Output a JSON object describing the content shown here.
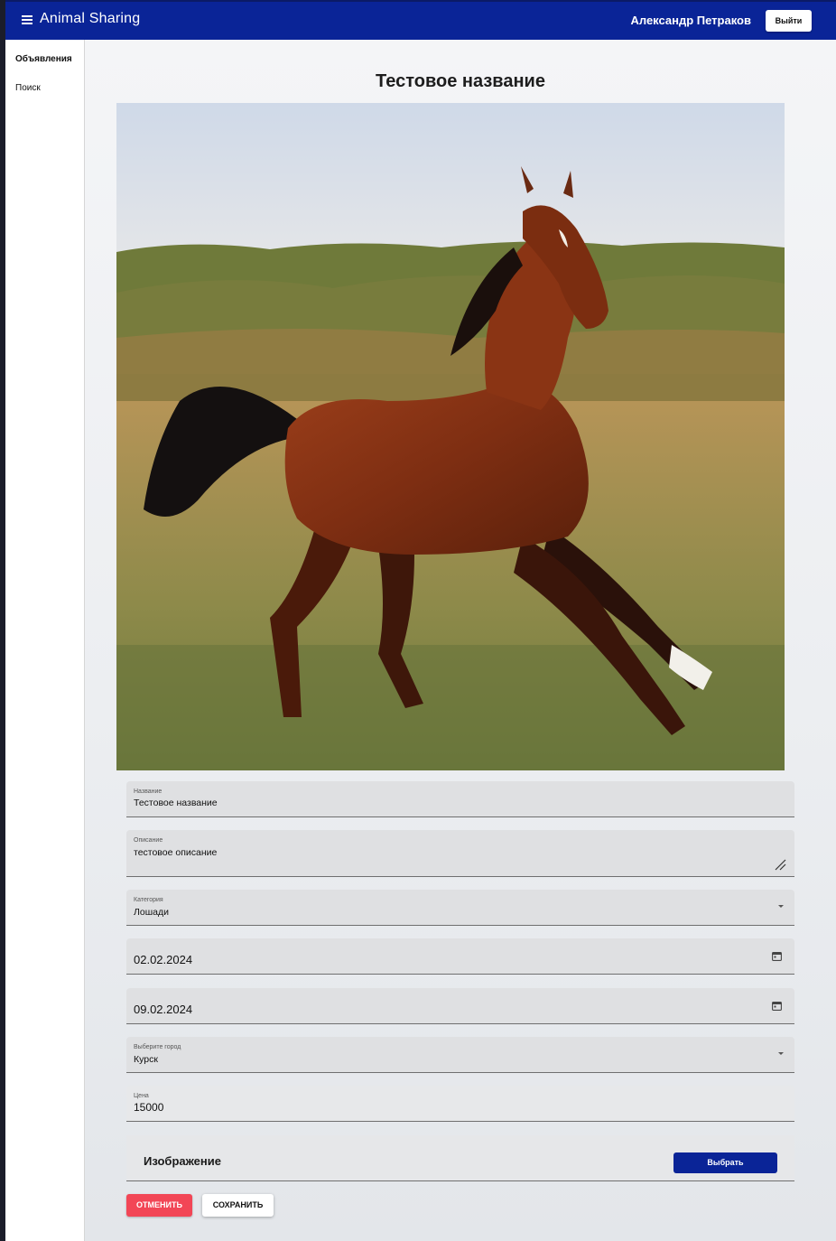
{
  "header": {
    "app_title": "Animal Sharing",
    "user_name": "Александр Петраков",
    "logout_label": "Выйти"
  },
  "sidebar": {
    "items": [
      {
        "label": "Объявления",
        "active": true
      },
      {
        "label": "Поиск",
        "active": false
      }
    ]
  },
  "page": {
    "title": "Тестовое название",
    "photo_icon": "horse-photo"
  },
  "form": {
    "name": {
      "label": "Название",
      "value": "Тестовое название"
    },
    "description": {
      "label": "Описание",
      "value": "тестовое описание"
    },
    "category": {
      "label": "Категория",
      "value": "Лошади"
    },
    "date_start": {
      "value": "02.02.2024"
    },
    "date_end": {
      "value": "09.02.2024"
    },
    "city": {
      "label": "Выберите город",
      "value": "Курск"
    },
    "price": {
      "label": "Цена",
      "value": "15000"
    },
    "image": {
      "label": "Изображение",
      "button": "Выбрать"
    }
  },
  "actions": {
    "cancel": "ОТМЕНИТЬ",
    "save": "СОХРАНИТЬ"
  },
  "colors": {
    "primary": "#0a2497",
    "cancel": "#f24656",
    "field_bg": "#dfe0e2"
  }
}
